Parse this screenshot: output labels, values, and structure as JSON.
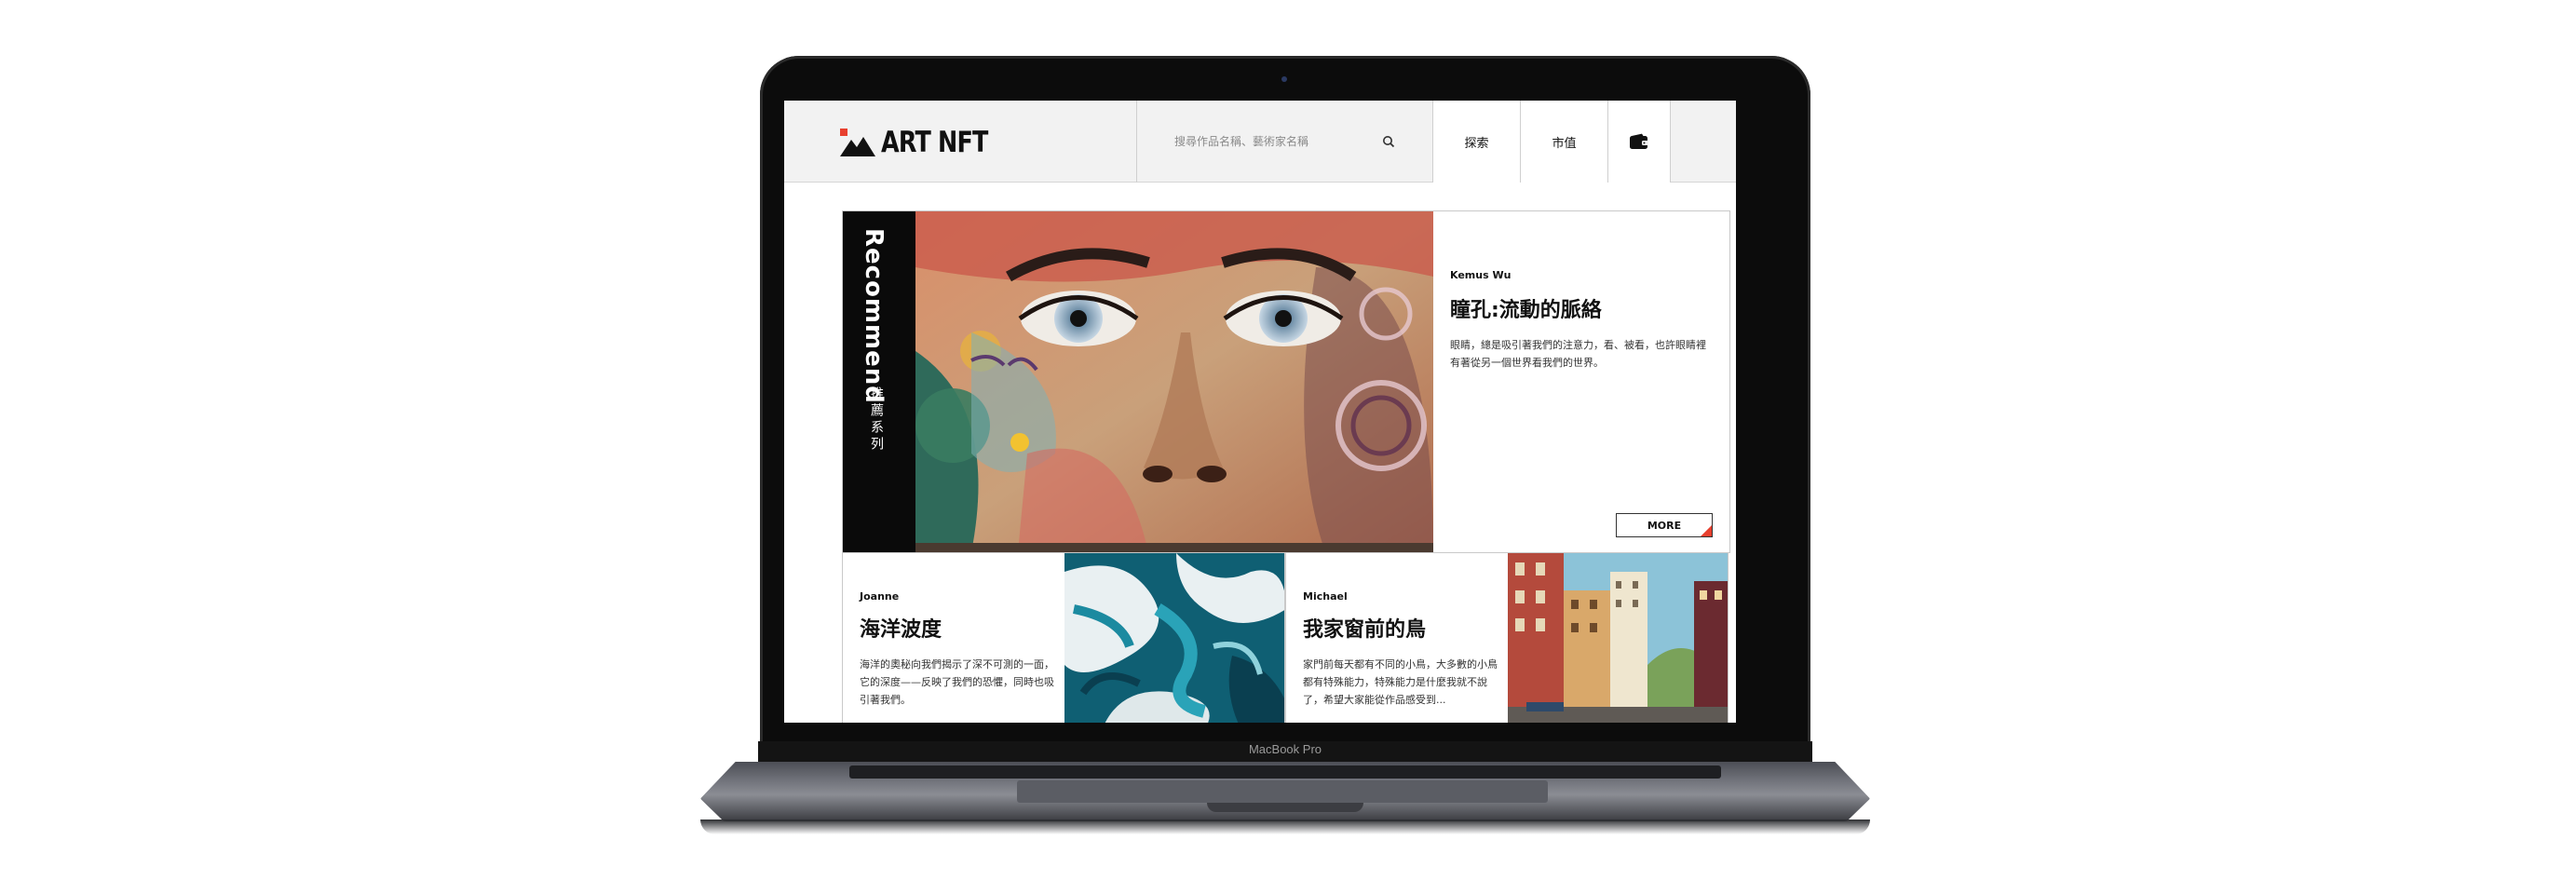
{
  "device": {
    "label": "MacBook Pro"
  },
  "header": {
    "logo_text": "ART NFT",
    "search": {
      "placeholder": "搜尋作品名稱、藝術家名稱"
    },
    "nav": [
      {
        "label": "探索"
      },
      {
        "label": "市值"
      }
    ]
  },
  "featured": {
    "band_title": "Recommend",
    "band_subtitle": "推薦系列",
    "artist": "Kemus Wu",
    "title": "瞳孔:流動的脈絡",
    "description": "眼睛，總是吸引著我們的注意力，看、被看，也許眼睛裡有著從另一個世界看我們的世界。",
    "more_label": "MORE"
  },
  "cards": [
    {
      "artist": "Joanne",
      "title": "海洋波度",
      "description": "海洋的奧秘向我們揭示了深不可測的一面，它的深度——反映了我們的恐懼，同時也吸引著我們。"
    },
    {
      "artist": "Michael",
      "title": "我家窗前的鳥",
      "description": "家門前每天都有不同的小鳥，大多數的小鳥都有特殊能力，特殊能力是什麼我就不說了，希望大家能從作品感受到..."
    }
  ],
  "colors": {
    "accent": "#e8402f",
    "band": "#0a0a0a",
    "nav_bg": "#f2f2f2"
  }
}
